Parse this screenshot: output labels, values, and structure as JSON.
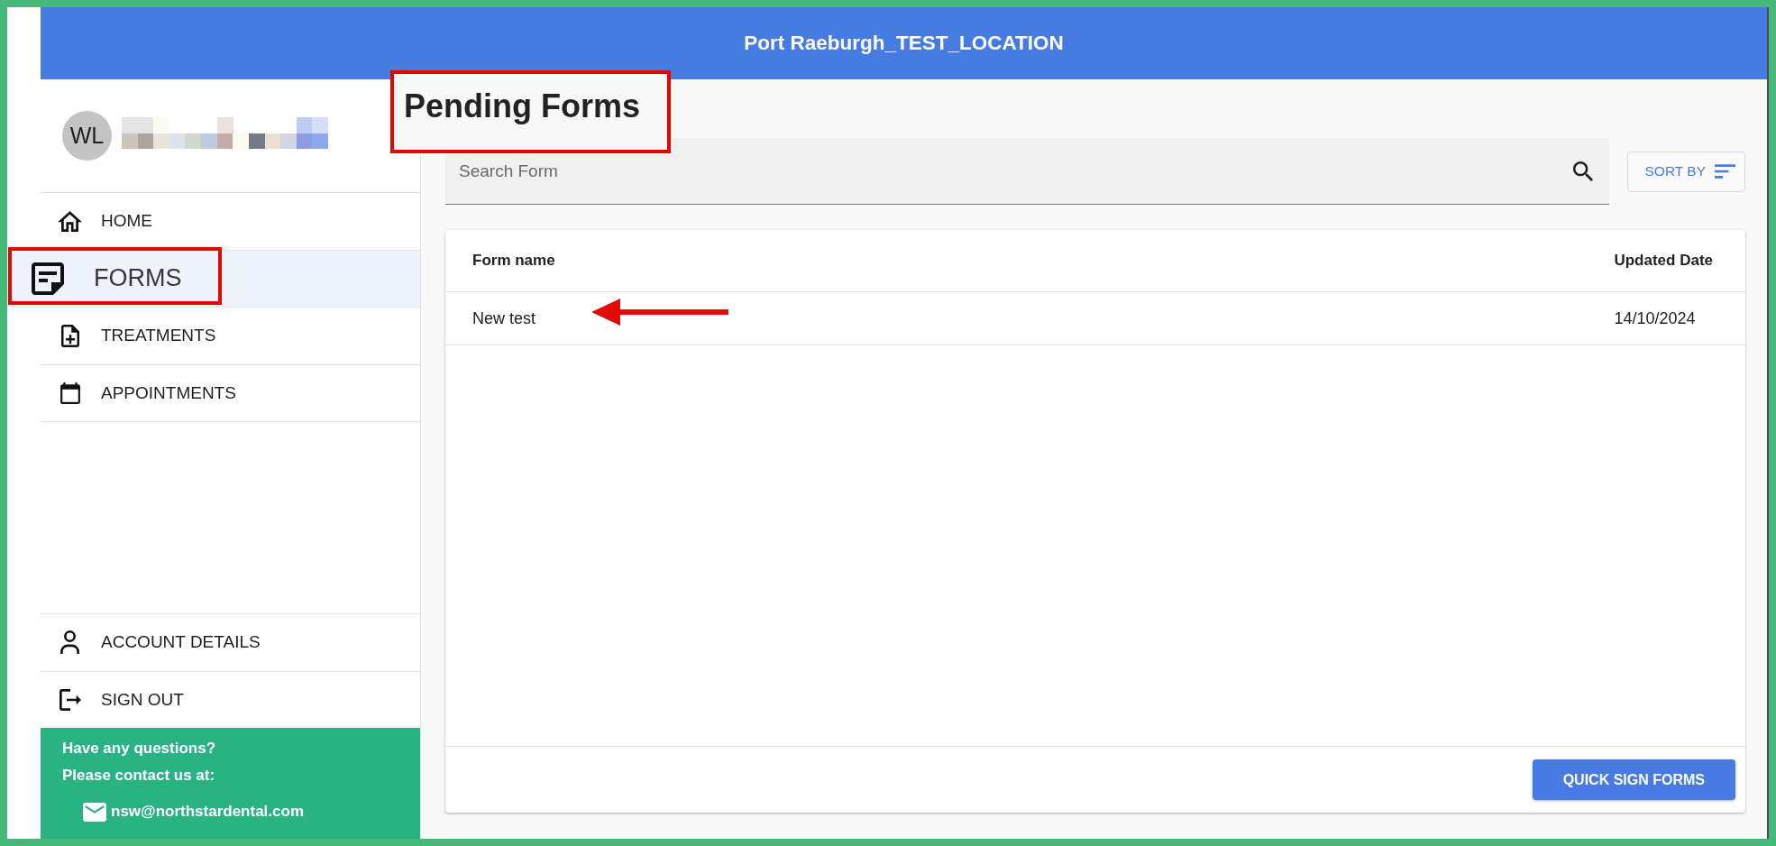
{
  "header": {
    "title": "Port Raeburgh_TEST_LOCATION"
  },
  "profile": {
    "initials": "WL"
  },
  "nav_items": [
    {
      "kind": "home",
      "label": "HOME",
      "selected": false,
      "annotated": false
    },
    {
      "kind": "forms",
      "label": "FORMS",
      "selected": true,
      "annotated": true
    },
    {
      "kind": "treatments",
      "label": "TREATMENTS",
      "selected": false,
      "annotated": false
    },
    {
      "kind": "appointments",
      "label": "APPOINTMENTS",
      "selected": false,
      "annotated": false
    }
  ],
  "account_items": [
    {
      "kind": "account",
      "label": "ACCOUNT DETAILS",
      "selected": false
    },
    {
      "kind": "signout",
      "label": "SIGN OUT",
      "selected": false
    }
  ],
  "help": {
    "lines": [
      "Have any questions?",
      "Please contact us at:"
    ],
    "email": "nsw@northstardental.com"
  },
  "heading": {
    "text": "Pending Forms",
    "annotated": true
  },
  "search": {
    "placeholder": "Search Form"
  },
  "sort_button": {
    "label": "SORT BY"
  },
  "table": {
    "columns": [
      "Form name",
      "Updated Date"
    ],
    "rows": [
      {
        "cells": [
          "New test",
          "14/10/2024"
        ],
        "annotated": true
      }
    ]
  },
  "footer_button": {
    "label": "QUICK SIGN FORMS"
  }
}
